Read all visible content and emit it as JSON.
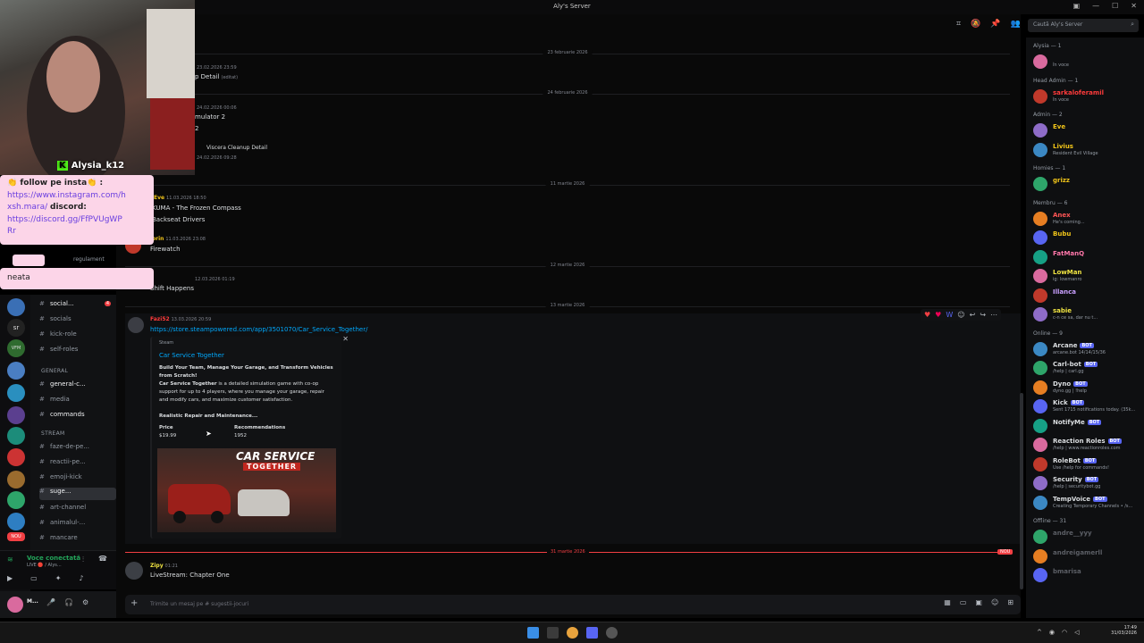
{
  "window": {
    "title": "Aly's Server",
    "minimize": "—",
    "maximize": "☐",
    "close": "✕"
  },
  "webcam": {
    "streamer": "Alysia_k12",
    "icon": "kick-logo-icon"
  },
  "stream_chat": {
    "line1": "👏 follow pe insta👏 :",
    "link_insta_1": "https://www.instagram.com/h",
    "link_insta_2": "xsh.mara/",
    "discord_label": "discord:",
    "link_discord_1": "https://discord.gg/FfPVUgWP",
    "link_discord_2": "Rr",
    "neata": "neata",
    "partial": "regulament"
  },
  "channels": {
    "items": [
      {
        "name": "social...",
        "badge": "4"
      },
      {
        "name": "socials"
      },
      {
        "name": "kick-role"
      },
      {
        "name": "self-roles"
      }
    ],
    "cat_general": "GENERAL",
    "general": [
      {
        "name": "general-c..."
      },
      {
        "name": "media"
      },
      {
        "name": "commands"
      }
    ],
    "cat_stream": "STREAM",
    "stream": [
      {
        "name": "faze-de-pe..."
      },
      {
        "name": "reactii-pe..."
      },
      {
        "name": "emoji-kick"
      },
      {
        "name": "suge..."
      },
      {
        "name": "art-channel"
      },
      {
        "name": "animalul-..."
      },
      {
        "name": "mancare"
      }
    ]
  },
  "voice": {
    "status": "Voce conectată",
    "sub": "LIVE 🔴 / Alys..."
  },
  "user": {
    "name": "M..."
  },
  "server_badges": {
    "sr": "sr",
    "vfm": "VFM",
    "nou": "NOU"
  },
  "messages": {
    "date1": "23 februarie 2026",
    "m1_meta": "23.02.2026 23:59",
    "m1_text": "p Detail",
    "m1_edit": "(editat)",
    "date2": "24 februarie 2026",
    "m2_meta": "24.02.2026 00:06",
    "m2_text1": "mulator 2",
    "m2_text2": "2",
    "m2_text3": "Viscera Cleanup Detail",
    "m2_meta2": "24.02.2026 09:28",
    "date3": "11 martie 2026",
    "m3_user": "Eve",
    "m3_meta": "11.03.2026 18:50",
    "m3_text1": "KUMA - The Frozen Compass",
    "m3_text2": "Backseat Drivers",
    "m4_user": "orin",
    "m4_meta": "11.03.2026 23:08",
    "m4_text": "Firewatch",
    "date4": "12 martie 2026",
    "m5_meta": "12.03.2026 01:19",
    "m5_text": "Shift Happens",
    "date5": "13 martie 2026",
    "m6_user": "Fazi52",
    "m6_meta": "13.03.2026 20:59",
    "m6_link": "https://store.steampowered.com/app/3501070/Car_Service_Together/",
    "date6": "31 martie 2026",
    "new_badge": "NOU",
    "m7_user": "Zipy",
    "m7_meta": "01:21",
    "m7_text": "LiveStream: Chapter One"
  },
  "embed": {
    "provider": "Steam",
    "title": "Car Service Together",
    "desc1": "Build Your Team, Manage Your Garage, and Transform Vehicles",
    "desc2": "from Scratch!",
    "desc3a": "Car Service Together",
    "desc3b": " is a detailed simulation game with co-op",
    "desc4": "support for up to 4 players, where you manage your garage, repair",
    "desc5": "and modify cars, and maximize customer satisfaction.",
    "desc6": "Realistic Repair and Maintenance...",
    "price_label": "Price",
    "price_value": "$19.99",
    "rec_label": "Recommendations",
    "rec_value": "1952",
    "image_title_1": "CAR SERVICE",
    "image_title_2": "TOGETHER"
  },
  "composer": {
    "placeholder": "Trimite un mesaj pe #",
    "channel": "sugestii-jocuri"
  },
  "search": {
    "placeholder": "Caută Aly's Server"
  },
  "members": {
    "groups": [
      {
        "header": "Alysia — 1",
        "items": [
          {
            "name": "",
            "status": "în voce",
            "color": "#e91e63"
          }
        ]
      },
      {
        "header": "Head Admin — 1",
        "items": [
          {
            "name": "sarkaloferamil",
            "status": "în voce",
            "color": "#ff3b3b"
          }
        ]
      },
      {
        "header": "Admin — 2",
        "items": [
          {
            "name": "Eve",
            "status": "",
            "color": "#f0c419"
          },
          {
            "name": "Livius",
            "status": "Resident Evil Village",
            "color": "#f0c419"
          }
        ]
      },
      {
        "header": "Homies — 1",
        "items": [
          {
            "name": "grizz",
            "status": "",
            "color": "#f0c419"
          }
        ]
      },
      {
        "header": "Membru — 6",
        "items": [
          {
            "name": "Anex",
            "status": "He's coming...",
            "color": "#ff5555"
          },
          {
            "name": "Bubu",
            "status": "",
            "color": "#f0c419"
          },
          {
            "name": "FatManQ",
            "status": "",
            "color": "#ff77aa"
          },
          {
            "name": "LowMan",
            "status": "ig: lowmanro",
            "color": "#f0e442"
          },
          {
            "name": "Illanca",
            "status": "",
            "color": "#c9a0ff"
          },
          {
            "name": "sabie",
            "status": "c-n ce sa, dar nu t...",
            "color": "#f0e442"
          }
        ]
      },
      {
        "header": "Online — 9",
        "items": [
          {
            "name": "Arcane",
            "status": "arcane.bot 14/14/15/36",
            "color": "#dbdee1",
            "bot": "BOT"
          },
          {
            "name": "Carl-bot",
            "status": "/help | carl.gg",
            "color": "#dbdee1",
            "bot": "BOT"
          },
          {
            "name": "Dyno",
            "status": "dyno.gg | !help",
            "color": "#dbdee1",
            "bot": "BOT"
          },
          {
            "name": "Kick",
            "status": "Sent 1715 notifications today. (35k...",
            "color": "#dbdee1",
            "bot": "BOT"
          },
          {
            "name": "NotifyMe",
            "status": "",
            "color": "#dbdee1",
            "bot": "BOT"
          },
          {
            "name": "Reaction Roles",
            "status": "/help | www.reactionroles.com",
            "color": "#dbdee1",
            "bot": "BOT"
          },
          {
            "name": "RoleBot",
            "status": "Use /help for commands!",
            "color": "#dbdee1",
            "bot": "BOT"
          },
          {
            "name": "Security",
            "status": "/help | securitybot.gg",
            "color": "#dbdee1",
            "bot": "BOT"
          },
          {
            "name": "TempVoice",
            "status": "Creating Temporary Channels • /s...",
            "color": "#dbdee1",
            "bot": "BOT"
          }
        ]
      },
      {
        "header": "Offline — 31",
        "items": [
          {
            "name": "andre__yyy",
            "status": "",
            "color": "#5c5f66"
          },
          {
            "name": "andreigamerll",
            "status": "",
            "color": "#5c5f66"
          },
          {
            "name": "bmarisa",
            "status": "",
            "color": "#5c5f66"
          }
        ]
      }
    ]
  },
  "taskbar": {
    "time": "17:49",
    "date": "31/03/2026"
  },
  "colors": {
    "accent": "#5865f2",
    "link": "#00a8fc",
    "new": "#f23f43"
  }
}
